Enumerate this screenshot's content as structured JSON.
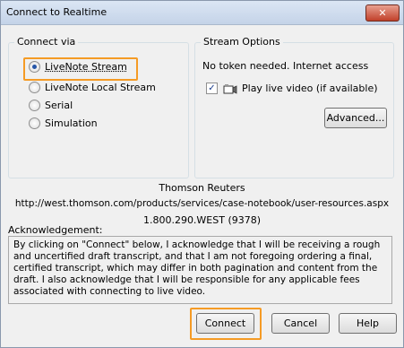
{
  "window": {
    "title": "Connect to Realtime",
    "close_glyph": "✕"
  },
  "connect_via": {
    "legend": "Connect via",
    "options": [
      {
        "label": "LiveNote Stream",
        "checked": true
      },
      {
        "label": "LiveNote Local Stream",
        "checked": false
      },
      {
        "label": "Serial",
        "checked": false
      },
      {
        "label": "Simulation",
        "checked": false
      }
    ]
  },
  "stream_options": {
    "legend": "Stream Options",
    "status": "No token needed. Internet access",
    "play_video_label": "Play live video (if available)",
    "play_video_checked": true,
    "advanced_label": "Advanced..."
  },
  "info": {
    "company": "Thomson Reuters",
    "url": "http://west.thomson.com/products/services/case-notebook/user-resources.aspx",
    "phone": "1.800.290.WEST (9378)"
  },
  "acknowledgement": {
    "label": "Acknowledgement:",
    "text": "By clicking on \"Connect\" below, I acknowledge that I will be receiving a rough and uncertified draft transcript, and that I am not foregoing ordering a final, certified transcript, which may differ in both pagination and content from the draft. I also acknowledge that I will be responsible for any applicable fees associated with connecting to live video."
  },
  "buttons": {
    "connect": "Connect",
    "cancel": "Cancel",
    "help": "Help"
  },
  "colors": {
    "highlight": "#f59b25",
    "radio_dot": "#2656a8"
  }
}
